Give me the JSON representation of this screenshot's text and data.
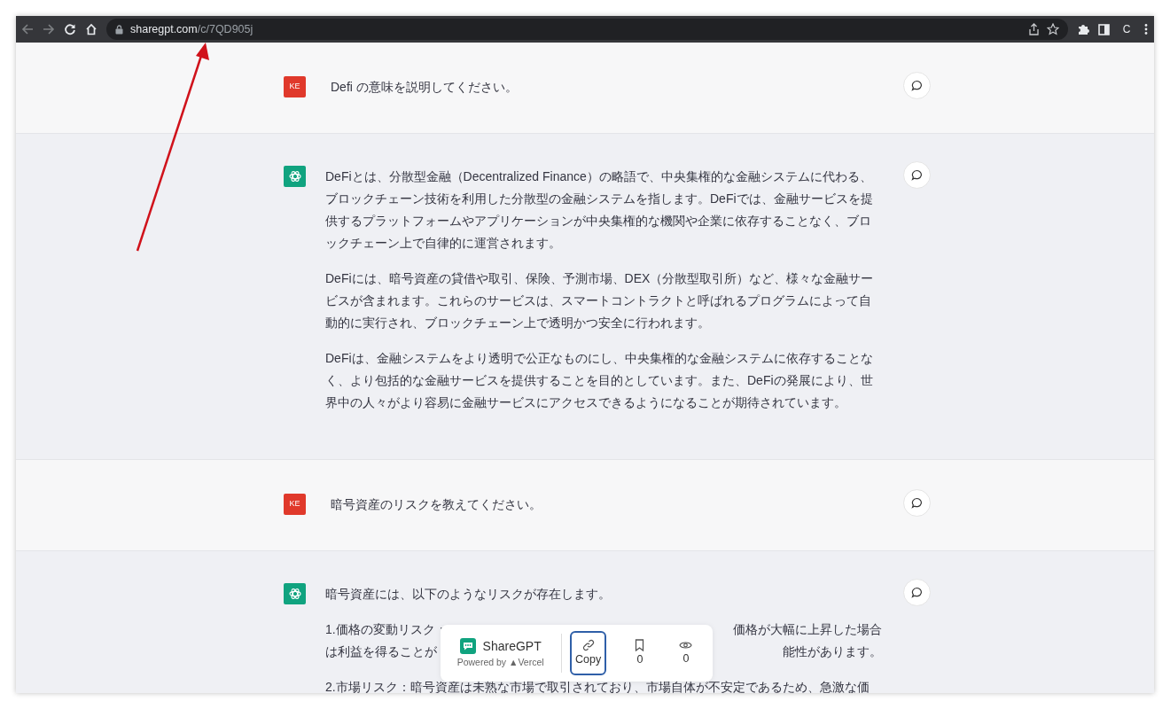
{
  "browser": {
    "url_host": "sharegpt.com",
    "url_path": "/c/7QD905j",
    "profile_initial": "C"
  },
  "messages": [
    {
      "kind": "user",
      "avatar": "KE",
      "paragraphs": [
        "Defi の意味を説明してください。"
      ]
    },
    {
      "kind": "assistant",
      "paragraphs": [
        "DeFiとは、分散型金融（Decentralized Finance）の略語で、中央集権的な金融システムに代わる、ブロックチェーン技術を利用した分散型の金融システムを指します。DeFiでは、金融サービスを提供するプラットフォームやアプリケーションが中央集権的な機関や企業に依存することなく、ブロックチェーン上で自律的に運営されます。",
        "DeFiには、暗号資産の貸借や取引、保険、予測市場、DEX（分散型取引所）など、様々な金融サービスが含まれます。これらのサービスは、スマートコントラクトと呼ばれるプログラムによって自動的に実行され、ブロックチェーン上で透明かつ安全に行われます。",
        "DeFiは、金融システムをより透明で公正なものにし、中央集権的な金融システムに依存することなく、より包括的な金融サービスを提供することを目的としています。また、DeFiの発展により、世界中の人々がより容易に金融サービスにアクセスできるようになることが期待されています。"
      ]
    },
    {
      "kind": "user",
      "avatar": "KE",
      "paragraphs": [
        "暗号資産のリスクを教えてください。"
      ]
    },
    {
      "kind": "assistant",
      "paragraphs": [
        "暗号資産には、以下のようなリスクが存在します。"
      ],
      "covered_lines": [
        {
          "left": "1.価格の変動リスク：",
          "right": "価格が大幅に上昇した場合"
        },
        {
          "left": "は利益を得ることが",
          "right": "能性があります。"
        }
      ],
      "cut_line": "2.市場リスク：暗号資産は未熟な市場で取引されており、市場自体が不安定であるため、急激な価"
    }
  ],
  "share_bar": {
    "brand": "ShareGPT",
    "powered_by": "Powered by ▲Vercel",
    "copy_label": "Copy",
    "bookmarks": "0",
    "views": "0"
  }
}
